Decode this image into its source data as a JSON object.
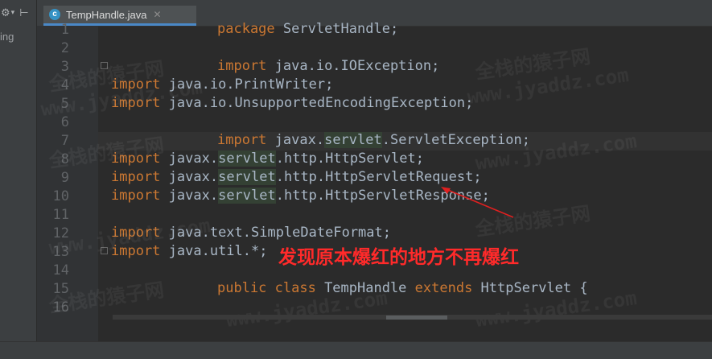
{
  "panel": {
    "settings_glyph": "⚙",
    "caret_glyph": "▾",
    "collapse_glyph": "⊢",
    "partial_text": "ing"
  },
  "tab": {
    "icon_letter": "c",
    "filename": "TempHandle.java",
    "close_glyph": "✕"
  },
  "gutter": {
    "line_numbers": [
      "1",
      "2",
      "3",
      "4",
      "5",
      "6",
      "7",
      "8",
      "9",
      "10",
      "11",
      "12",
      "13",
      "14",
      "15",
      "16"
    ]
  },
  "code": {
    "l1_kw": "package",
    "l1_rest": " ServletHandle;",
    "l3_kw": "import",
    "l3_rest": " java.io.IOException;",
    "l4_kw": "import",
    "l4_rest": " java.io.PrintWriter;",
    "l5_kw": "import",
    "l5_rest": " java.io.UnsupportedEncodingException;",
    "l7_kw": "import",
    "l7_a": " javax.",
    "l7_hl": "servlet",
    "l7_b": ".ServletException;",
    "l8_kw": "import",
    "l8_a": " javax.",
    "l8_hl": "servlet",
    "l8_b": ".http.HttpServlet;",
    "l9_kw": "import",
    "l9_a": " javax.",
    "l9_hl": "servlet",
    "l9_b": ".http.HttpServletRequest;",
    "l10_kw": "import",
    "l10_a": " javax.",
    "l10_hl": "servlet",
    "l10_b": ".http.HttpServletResponse;",
    "l12_kw": "import",
    "l12_rest": " java.text.SimpleDateFormat;",
    "l13_kw": "import",
    "l13_rest": " java.util.*;",
    "l15_kw1": "public class",
    "l15_mid": " TempHandle ",
    "l15_kw2": "extends",
    "l15_rest": " HttpServlet {"
  },
  "annotation": {
    "text": "发现原本爆红的地方不再爆红",
    "color": "#ff2a2a"
  },
  "watermark": {
    "line1": "全栈的猿子网",
    "line2": "www.jyaddz.com"
  },
  "colors": {
    "keyword": "#cc7832",
    "text": "#a9b7c6",
    "background": "#2b2b2b",
    "tab_accent": "#4a88c7"
  }
}
